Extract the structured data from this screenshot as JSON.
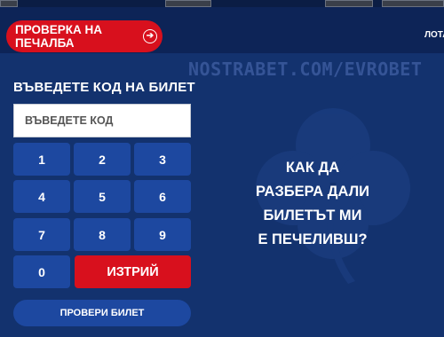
{
  "header": {
    "check_winnings_label": "ПРОВЕРКА НА ПЕЧАЛБА",
    "lotto_link_label": "ЛОТА"
  },
  "watermark": "NOSTRABET.COM/EVROBET",
  "ticket_panel": {
    "title": "ВЪВЕДЕТЕ КОД НА БИЛЕТ",
    "input_placeholder": "ВЪВЕДЕТЕ КОД",
    "input_value": "",
    "keys": [
      "1",
      "2",
      "3",
      "4",
      "5",
      "6",
      "7",
      "8",
      "9",
      "0"
    ],
    "delete_label": "ИЗТРИЙ",
    "submit_label": "ПРОВЕРИ БИЛЕТ"
  },
  "help": {
    "line1": "КАК ДА",
    "line2": "РАЗБЕРА ДАЛИ",
    "line3": "БИЛЕТЪТ МИ",
    "line4": "Е ПЕЧЕЛИВШ?"
  },
  "colors": {
    "background": "#13326e",
    "header": "#0d2457",
    "accent_red": "#d8101d",
    "key_blue": "#1d48a0"
  },
  "icons": {
    "check_button": "arrow-circle-right-icon",
    "background_decoration": "clover-icon"
  }
}
